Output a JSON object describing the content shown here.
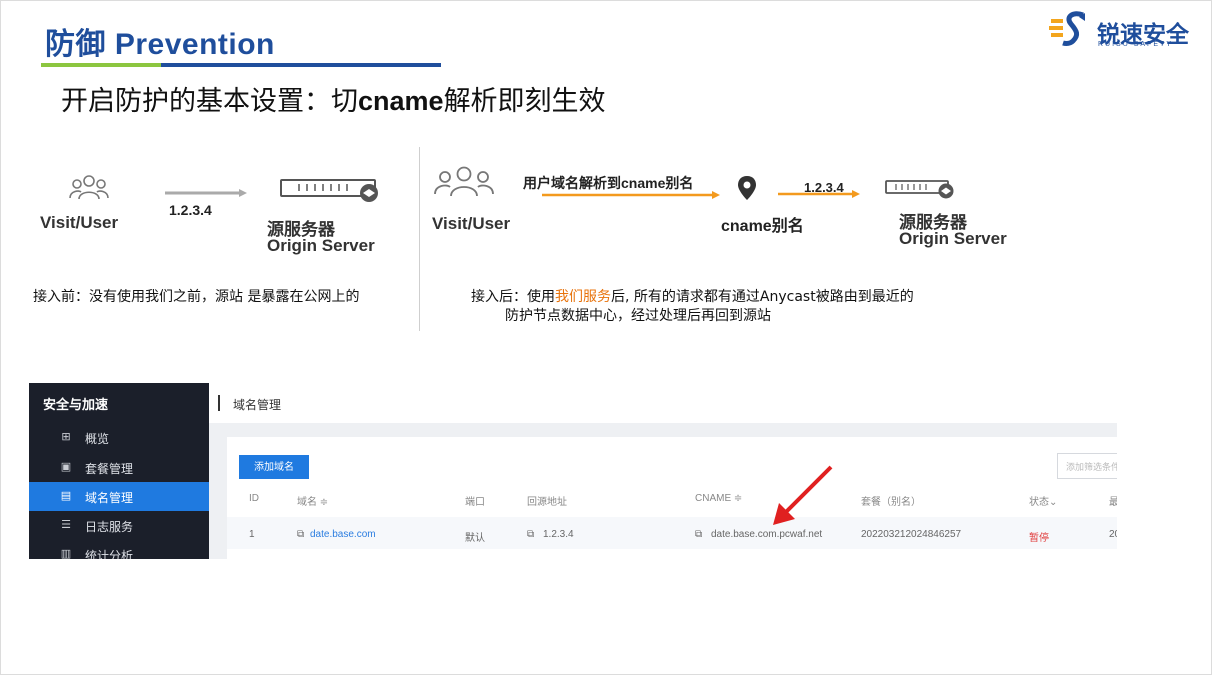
{
  "header": {
    "title": "防御 Prevention",
    "logo_cn": "锐速安全",
    "logo_en": "RUISU SAFETY"
  },
  "subtitle": {
    "prefix": "开启防护的基本设置：切",
    "bold": "cname",
    "suffix": "解析即刻生效"
  },
  "before": {
    "user_label": "Visit/User",
    "ip": "1.2.3.4",
    "server_cn": "源服务器",
    "server_en": "Origin Server",
    "desc": "接入前：没有使用我们之前，源站 是暴露在公网上的"
  },
  "after": {
    "user_label": "Visit/User",
    "resolve_label": "用户域名解析到cname别名",
    "cname_label": "cname别名",
    "ip": "1.2.3.4",
    "server_cn": "源服务器",
    "server_en": "Origin Server",
    "desc_line1_pre": "接入后：使用",
    "desc_line1_highlight": "我们服务",
    "desc_line1_post": "后, 所有的请求都有通过Anycast被路由到最近的",
    "desc_line2": "防护节点数据中心，经过处理后再回到源站"
  },
  "console": {
    "sidebar_title": "安全与加速",
    "sidebar_items": [
      {
        "label": "概览",
        "icon": "grid-icon"
      },
      {
        "label": "套餐管理",
        "icon": "package-icon"
      },
      {
        "label": "域名管理",
        "icon": "domain-icon",
        "active": true
      },
      {
        "label": "日志服务",
        "icon": "list-icon"
      },
      {
        "label": "统计分析",
        "icon": "chart-icon"
      }
    ],
    "page_title": "域名管理",
    "add_button": "添加域名",
    "search_placeholder": "添加筛选条件",
    "columns": [
      "ID",
      "域名 ≑",
      "端口",
      "回源地址",
      "CNAME ≑",
      "套餐（别名）",
      "状态⌄",
      "最"
    ],
    "row": {
      "id": "1",
      "domain": "date.base.com",
      "port": "默认",
      "origin": "1.2.3.4",
      "cname": "date.base.com.pcwaf.net",
      "plan": "202203212024846257",
      "status": "暂停",
      "last": "20"
    },
    "colors": {
      "accent": "#1f7ae0",
      "status": "#e03a3a",
      "arrow": "#e02020"
    }
  }
}
